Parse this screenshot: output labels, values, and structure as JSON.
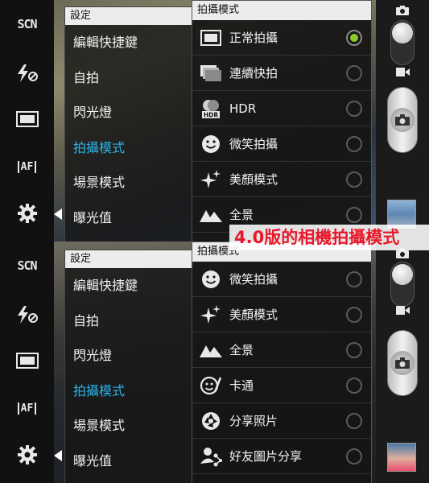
{
  "left_toolbar": {
    "scn_label": "SCN",
    "af_label": "AF",
    "icons": [
      "scn-icon",
      "flash-off-icon",
      "aspect-ratio-icon",
      "af-icon",
      "gear-icon"
    ]
  },
  "panels": [
    {
      "settings": {
        "title": "設定",
        "items": [
          "編輯快捷鍵",
          "自拍",
          "閃光燈",
          "拍攝模式",
          "場景模式",
          "曝光值"
        ],
        "active_index": 3
      },
      "modes": {
        "title": "拍攝模式",
        "items": [
          {
            "label": "正常拍攝",
            "icon": "normal-shot-icon",
            "selected": true
          },
          {
            "label": "連續快拍",
            "icon": "burst-shot-icon",
            "selected": false
          },
          {
            "label": "HDR",
            "icon": "hdr-icon",
            "selected": false
          },
          {
            "label": "微笑拍攝",
            "icon": "smile-icon",
            "selected": false
          },
          {
            "label": "美顏模式",
            "icon": "sparkle-icon",
            "selected": false
          },
          {
            "label": "全景",
            "icon": "panorama-icon",
            "selected": false
          }
        ]
      }
    },
    {
      "settings": {
        "title": "設定",
        "items": [
          "編輯快捷鍵",
          "自拍",
          "閃光燈",
          "拍攝模式",
          "場景模式",
          "曝光值"
        ],
        "active_index": 3
      },
      "modes": {
        "title": "拍攝模式",
        "items": [
          {
            "label": "微笑拍攝",
            "icon": "smile-icon",
            "selected": false
          },
          {
            "label": "美顏模式",
            "icon": "sparkle-icon",
            "selected": false
          },
          {
            "label": "全景",
            "icon": "panorama-icon",
            "selected": false
          },
          {
            "label": "卡通",
            "icon": "cartoon-icon",
            "selected": false
          },
          {
            "label": "分享照片",
            "icon": "share-shot-icon",
            "selected": false
          },
          {
            "label": "好友圖片分享",
            "icon": "buddy-share-icon",
            "selected": false
          }
        ]
      }
    }
  ],
  "hdr_badge": "HDR",
  "caption": "4.0版的相機拍攝模式",
  "colors": {
    "active_text": "#2ab3e8",
    "radio_selected": "#8ccc2a",
    "caption_text": "#e8182b"
  }
}
